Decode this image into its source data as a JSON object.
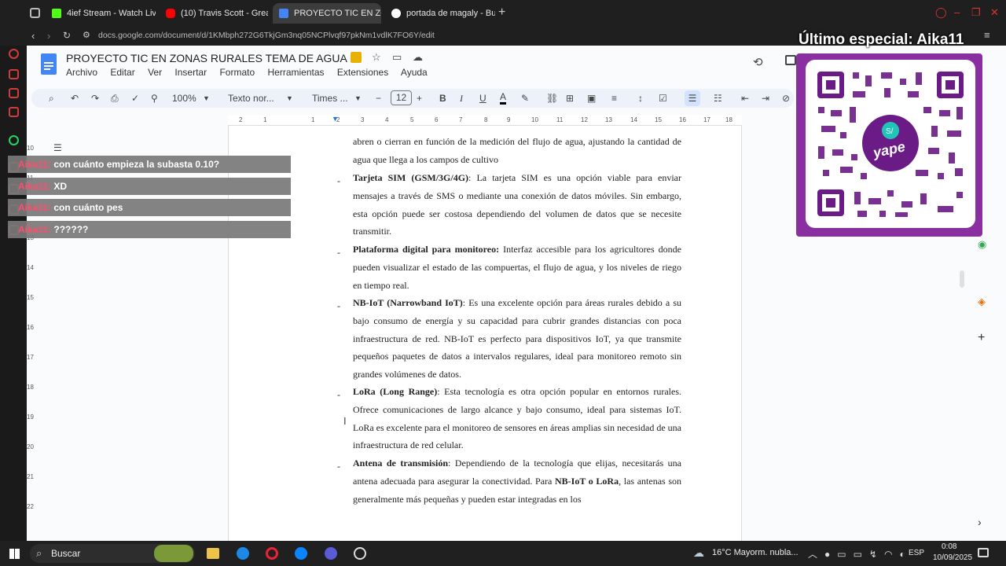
{
  "browser": {
    "tabs": [
      {
        "label": "4ief Stream - Watch Live",
        "color": "#53fc18"
      },
      {
        "label": "(10) Travis Scott - Greate",
        "color": "#ff0000"
      },
      {
        "label": "PROYECTO TIC EN ZONA",
        "color": "#4285f4",
        "active": true
      },
      {
        "label": "portada de magaly - Busc",
        "color": "#ffffff"
      }
    ],
    "url": "docs.google.com/document/d/1KMbph272G6TkjGm3nq05NCPlvqf97pkNm1vdlK7FO6Y/edit"
  },
  "doc": {
    "title": "PROYECTO TIC EN ZONAS RURALES TEMA DE AGUA",
    "menu": [
      "Archivo",
      "Editar",
      "Ver",
      "Insertar",
      "Formato",
      "Herramientas",
      "Extensiones",
      "Ayuda"
    ],
    "toolbar": {
      "zoom": "100%",
      "style": "Texto nor...",
      "font": "Times ...",
      "font_size": "12"
    },
    "ruler_ticks": [
      "2",
      "1",
      "1",
      "2",
      "3",
      "4",
      "5",
      "6",
      "7",
      "8",
      "9",
      "10",
      "11",
      "12",
      "13",
      "14",
      "15",
      "16",
      "17",
      "18"
    ],
    "line_numbers": [
      "10",
      "11",
      "12",
      "13",
      "14",
      "15",
      "16",
      "17",
      "18",
      "19",
      "20",
      "21",
      "22",
      "23",
      "24"
    ],
    "top_fragment": "abren o cierran en función de la medición del flujo de agua, ajustando la cantidad de agua que llega a los campos de cultivo",
    "items": [
      {
        "title": "Tarjeta SIM (GSM/3G/4G)",
        "text": ": La tarjeta SIM es una opción viable para enviar mensajes a través de SMS o mediante una conexión de datos móviles. Sin embargo, esta opción puede ser costosa dependiendo del volumen de datos que se necesite transmitir."
      },
      {
        "title": "Plataforma digital para monitoreo:",
        "text": " Interfaz accesible para los agricultores donde pueden visualizar el estado de las compuertas, el flujo de agua, y los niveles de riego en tiempo real."
      },
      {
        "title": "NB-IoT (Narrowband IoT)",
        "text": ": Es una excelente opción para áreas rurales debido a su bajo consumo de energía y su capacidad para cubrir grandes distancias con poca infraestructura de red. NB-IoT es perfecto para dispositivos IoT, ya que transmite pequeños paquetes de datos a intervalos regulares, ideal para monitoreo remoto sin grandes volúmenes de datos."
      },
      {
        "title": "LoRa (Long Range)",
        "text": ": Esta tecnología es otra opción popular en entornos rurales. Ofrece comunicaciones de largo alcance y bajo consumo, ideal para sistemas IoT. LoRa es excelente para el monitoreo de sensores en áreas amplias sin necesidad de una infraestructura de red celular."
      },
      {
        "title": "Antena de transmisión",
        "text": ": Dependiendo de la tecnología que elijas, necesitarás una antena adecuada para asegurar la conectividad. Para ",
        "bold2": "NB-IoT o LoRa",
        "text2": ", las antenas son generalmente más pequeñas y pueden estar integradas en los"
      }
    ]
  },
  "chat": [
    {
      "user": "Aika11:",
      "msg": "con cuánto empieza la subasta 0.10?"
    },
    {
      "user": "Aika11:",
      "msg": "XD"
    },
    {
      "user": "Aika11:",
      "msg": "con cuánto pes"
    },
    {
      "user": "Aika11:",
      "msg": "??????"
    }
  ],
  "overlay": {
    "title": "Último especial: Aika11",
    "qr_brand": "yape"
  },
  "taskbar": {
    "search": "Buscar",
    "weather": "16°C  Mayorm. nubla...",
    "lang": "ESP",
    "time": "0:08",
    "date": "10/09/2025"
  }
}
